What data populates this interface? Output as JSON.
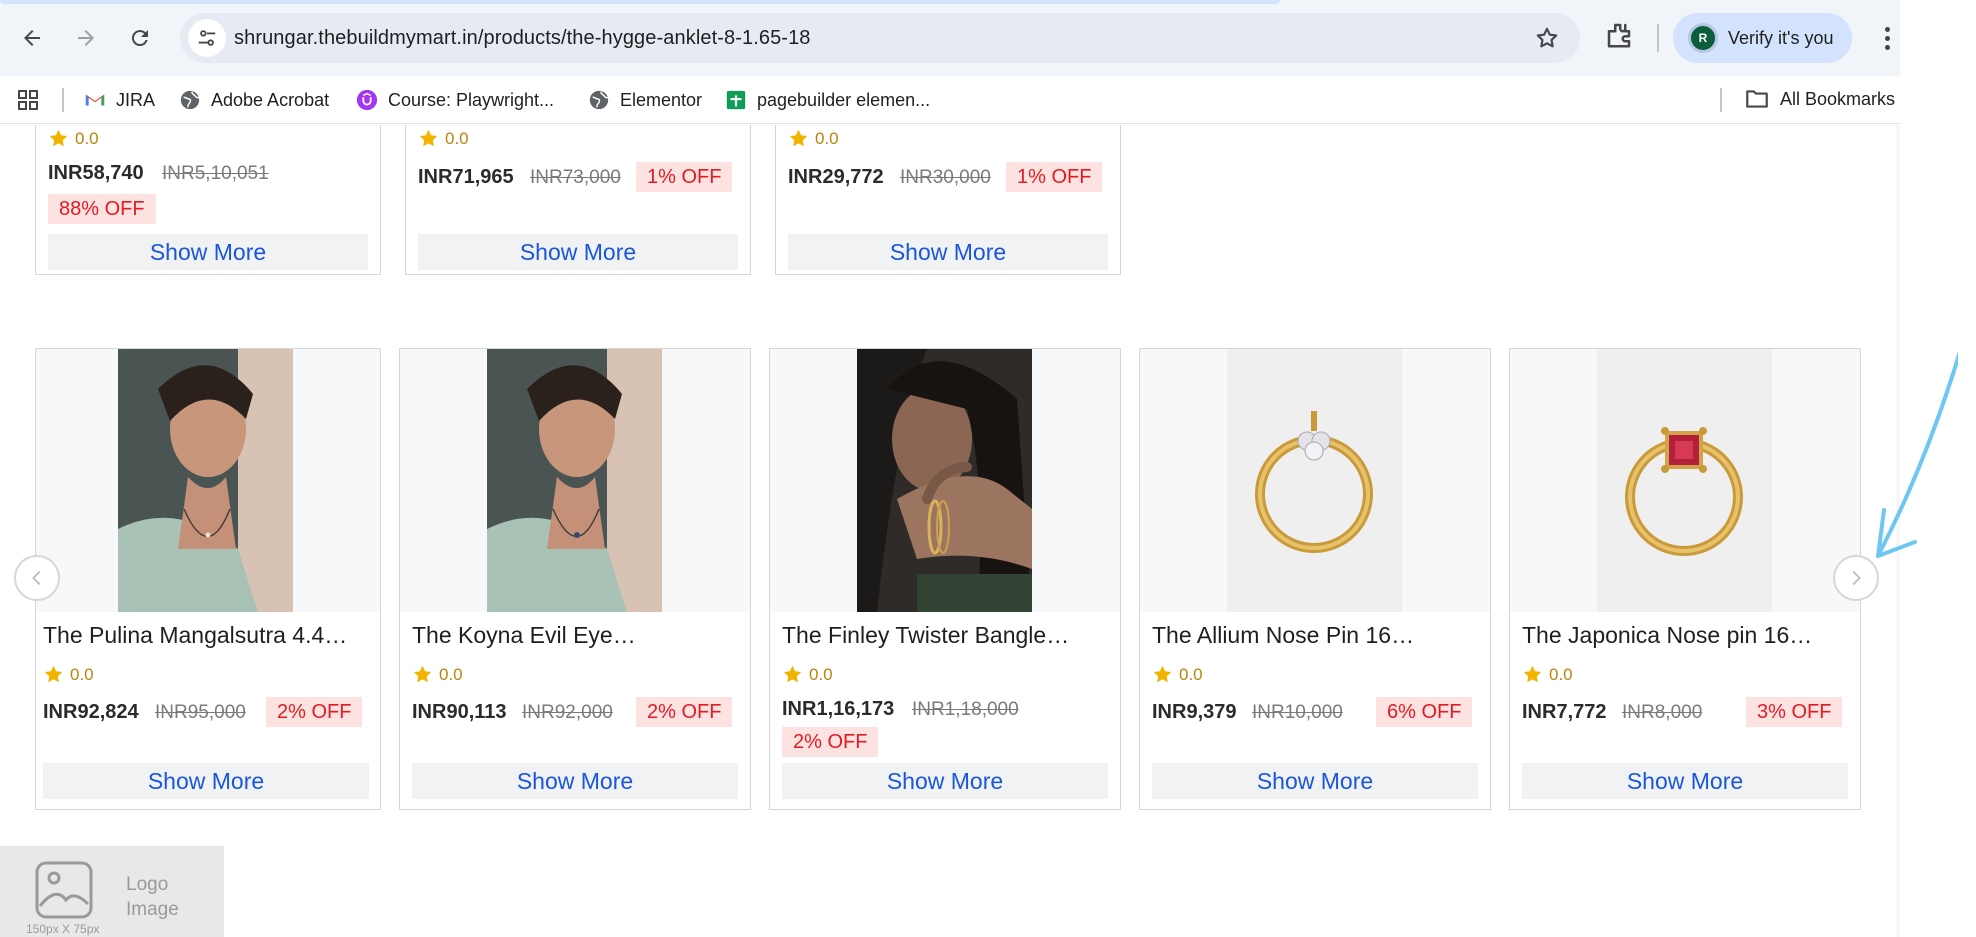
{
  "browser": {
    "url": "shrungar.thebuildmymart.in/products/the-hygge-anklet-8-1.65-18",
    "profile_initial": "R",
    "verify_label": "Verify it's you"
  },
  "bookmarks": {
    "items": [
      {
        "label": "JIRA",
        "icon": "gmail-icon"
      },
      {
        "label": "Adobe Acrobat",
        "icon": "globe-icon"
      },
      {
        "label": "Course: Playwright...",
        "icon": "udemy-icon"
      },
      {
        "label": "Elementor",
        "icon": "globe-icon"
      },
      {
        "label": "pagebuilder elemen...",
        "icon": "sheets-icon"
      }
    ],
    "all_label": "All Bookmarks"
  },
  "top_row": [
    {
      "rating": "0.0",
      "price": "INR58,740",
      "mrp": "INR5,10,051",
      "off": "88% OFF",
      "show_more": "Show More"
    },
    {
      "rating": "0.0",
      "price": "INR71,965",
      "mrp": "INR73,000",
      "off": "1% OFF",
      "show_more": "Show More"
    },
    {
      "rating": "0.0",
      "price": "INR29,772",
      "mrp": "INR30,000",
      "off": "1% OFF",
      "show_more": "Show More"
    }
  ],
  "carousel": {
    "products": [
      {
        "name": "The Pulina Mangalsutra 4.4…",
        "rating": "0.0",
        "price": "INR92,824",
        "mrp": "INR95,000",
        "off": "2% OFF",
        "show_more": "Show More",
        "image": "woman-necklace"
      },
      {
        "name": "The Koyna Evil Eye…",
        "rating": "0.0",
        "price": "INR90,113",
        "mrp": "INR92,000",
        "off": "2% OFF",
        "show_more": "Show More",
        "image": "woman-necklace"
      },
      {
        "name": "The Finley Twister Bangle…",
        "rating": "0.0",
        "price": "INR1,16,173",
        "mrp": "INR1,18,000",
        "off": "2% OFF",
        "show_more": "Show More",
        "image": "woman-bangle"
      },
      {
        "name": "The Allium Nose Pin 16…",
        "rating": "0.0",
        "price": "INR9,379",
        "mrp": "INR10,000",
        "off": "6% OFF",
        "show_more": "Show More",
        "image": "nose-pin-diamond"
      },
      {
        "name": "The Japonica Nose pin 16…",
        "rating": "0.0",
        "price": "INR7,772",
        "mrp": "INR8,000",
        "off": "3% OFF",
        "show_more": "Show More",
        "image": "nose-pin-ruby"
      }
    ]
  },
  "footer": {
    "logo_text_1": "Logo",
    "logo_text_2": "Image",
    "logo_size": "150px X 75px"
  },
  "colors": {
    "accent_link": "#1a56db",
    "discount_red": "#e31b23",
    "discount_bg": "#fde2e2",
    "star": "#f0b400",
    "annotation_arrow": "#6ec6f2"
  }
}
